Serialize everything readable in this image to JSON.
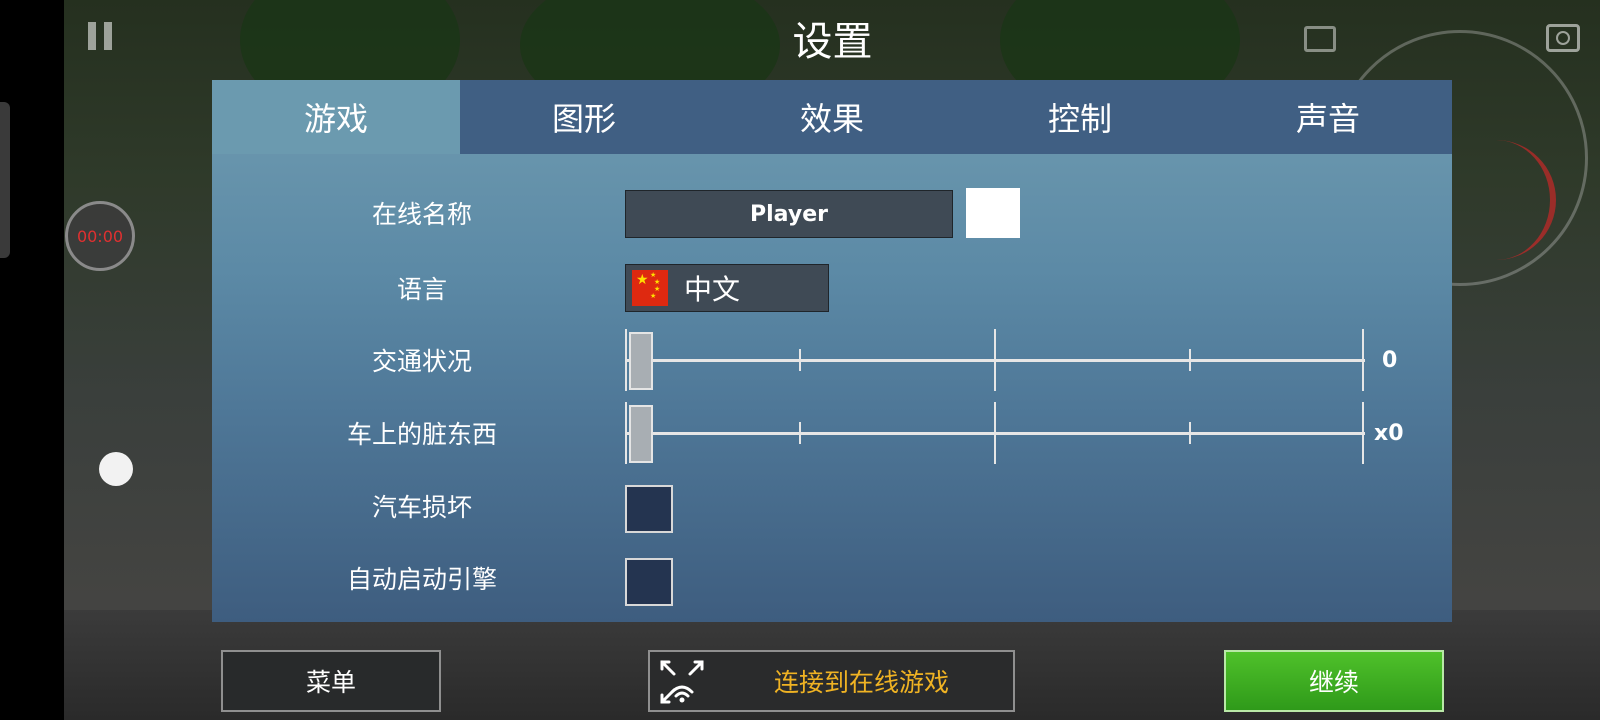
{
  "page": {
    "title": "设置"
  },
  "hud": {
    "timer": "00:00"
  },
  "tabs": [
    {
      "label": "游戏",
      "active": true
    },
    {
      "label": "图形",
      "active": false
    },
    {
      "label": "效果",
      "active": false
    },
    {
      "label": "控制",
      "active": false
    },
    {
      "label": "声音",
      "active": false
    }
  ],
  "settings": {
    "online_name": {
      "label": "在线名称",
      "value": "Player",
      "color": "#ffffff"
    },
    "language": {
      "label": "语言",
      "value": "中文",
      "flag": "china-flag"
    },
    "traffic": {
      "label": "交通状况",
      "value_text": "0",
      "level": 0
    },
    "car_dirt": {
      "label": "车上的脏东西",
      "value_text": "x0",
      "level": 0
    },
    "car_damage": {
      "label": "汽车损坏",
      "checked": false
    },
    "auto_start_engine": {
      "label": "自动启动引擎",
      "checked": false
    }
  },
  "buttons": {
    "menu": "菜单",
    "connect_online": "连接到在线游戏",
    "continue": "继续"
  },
  "colors": {
    "accent_online": "#f0b323",
    "continue_green": "#3faf22",
    "tab_active": "#6b9aaf",
    "tab_bar": "#405f83"
  }
}
